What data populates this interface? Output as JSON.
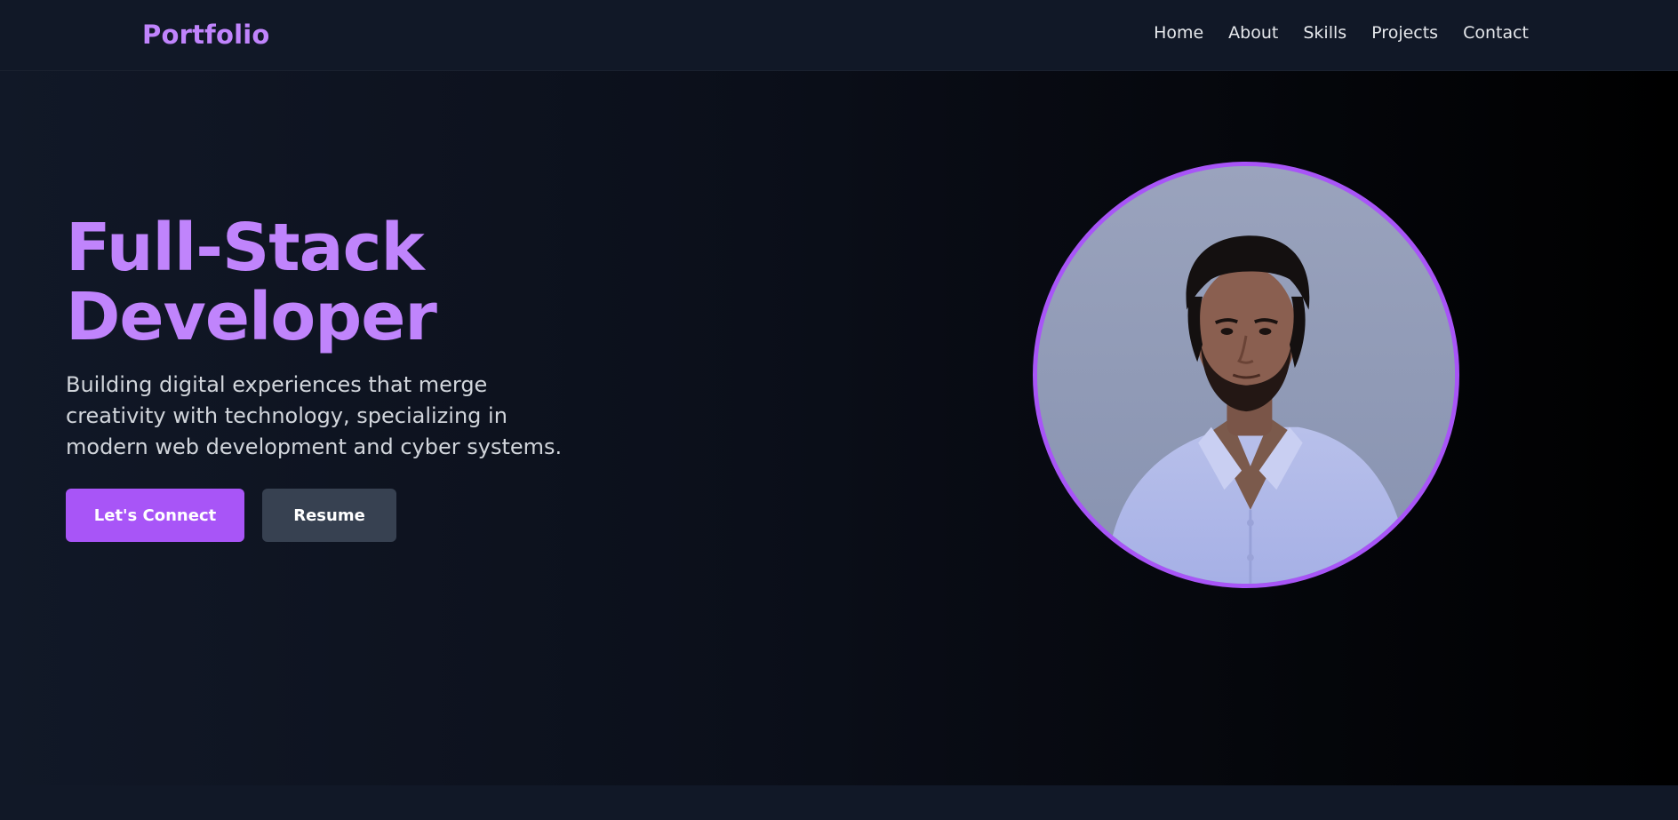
{
  "brand": "Portfolio",
  "nav": {
    "items": [
      "Home",
      "About",
      "Skills",
      "Projects",
      "Contact"
    ]
  },
  "hero": {
    "title_line1": "Full-Stack",
    "title_line2": "Developer",
    "subtitle": "Building digital experiences that merge creativity with technology, specializing in modern web development and cyber systems.",
    "primary_button": "Let's Connect",
    "secondary_button": "Resume"
  },
  "colors": {
    "accent": "#a855f7",
    "accent_light": "#c084fc",
    "background": "#111827",
    "secondary_button": "#374151"
  }
}
